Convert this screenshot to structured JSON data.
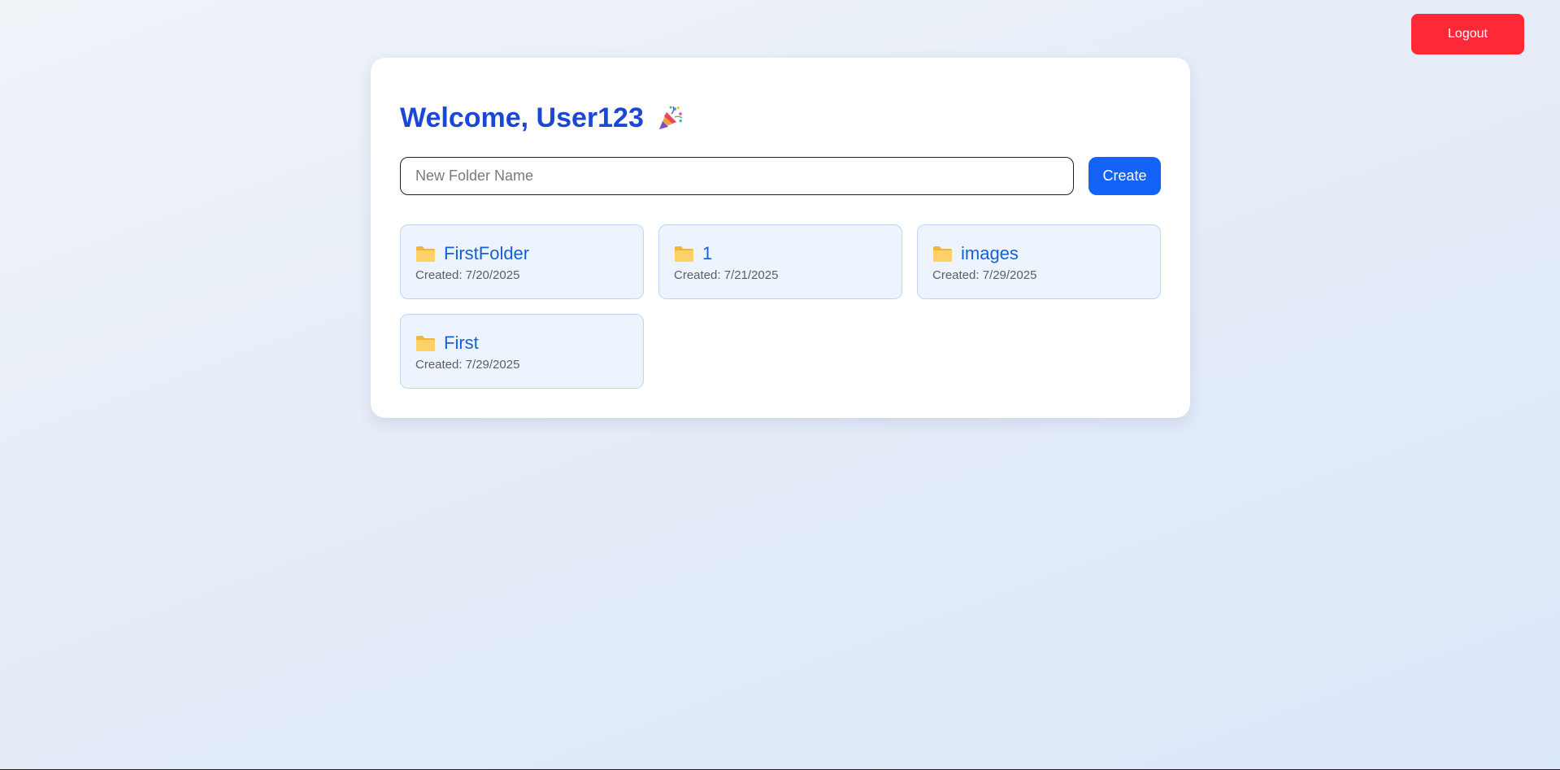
{
  "header": {
    "logout_label": "Logout"
  },
  "dashboard": {
    "welcome": "Welcome, User123",
    "welcome_icon": "party-popper-icon",
    "new_folder": {
      "placeholder": "New Folder Name",
      "value": ""
    },
    "create_label": "Create",
    "folders": [
      {
        "name": "FirstFolder",
        "created": "Created: 7/20/2025",
        "icon": "folder-icon"
      },
      {
        "name": "1",
        "created": "Created: 7/21/2025",
        "icon": "folder-icon"
      },
      {
        "name": "images",
        "created": "Created: 7/29/2025",
        "icon": "folder-icon"
      },
      {
        "name": "First",
        "created": "Created: 7/29/2025",
        "icon": "folder-icon"
      }
    ]
  },
  "colors": {
    "accent": "#1462f8",
    "heading": "#1a47d6",
    "logout": "#fe2837",
    "folder_card_bg": "#edf4fe",
    "folder_card_border": "#bed6f3",
    "folder_name": "#1560d4"
  }
}
